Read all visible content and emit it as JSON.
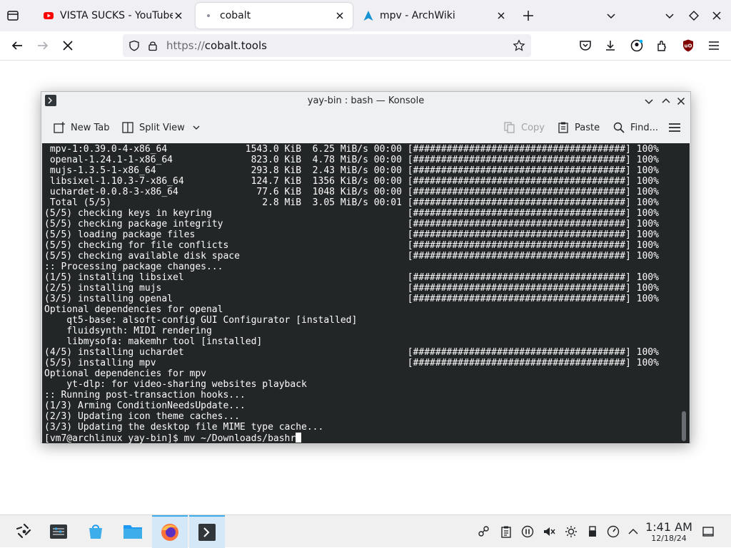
{
  "browser": {
    "tabs": [
      {
        "title": "VISTA SUCKS - YouTube",
        "icon": "youtube-icon",
        "active": false
      },
      {
        "title": "cobalt",
        "icon": "cobalt-icon",
        "active": true
      },
      {
        "title": "mpv - ArchWiki",
        "icon": "archlinux-icon",
        "active": false
      }
    ],
    "url_scheme": "https://",
    "url_host": "cobalt.tools"
  },
  "konsole": {
    "title": "yay-bin : bash — Konsole",
    "toolbar": {
      "new_tab": "New Tab",
      "split_view": "Split View",
      "copy": "Copy",
      "paste": "Paste",
      "find": "Find..."
    },
    "terminal_lines": [
      " mpv-1:0.39.0-4-x86_64              1543.0 KiB  6.25 MiB/s 00:00 [######################################] 100%",
      " openal-1.24.1-1-x86_64              823.0 KiB  4.78 MiB/s 00:00 [######################################] 100%",
      " mujs-1.3.5-1-x86_64                 293.8 KiB  2.43 MiB/s 00:00 [######################################] 100%",
      " libsixel-1.10.3-7-x86_64            124.7 KiB  1356 KiB/s 00:00 [######################################] 100%",
      " uchardet-0.0.8-3-x86_64              77.6 KiB  1048 KiB/s 00:00 [######################################] 100%",
      " Total (5/5)                           2.8 MiB  3.05 MiB/s 00:01 [######################################] 100%",
      "(5/5) checking keys in keyring                                   [######################################] 100%",
      "(5/5) checking package integrity                                 [######################################] 100%",
      "(5/5) loading package files                                      [######################################] 100%",
      "(5/5) checking for file conflicts                                [######################################] 100%",
      "(5/5) checking available disk space                              [######################################] 100%",
      ":: Processing package changes...",
      "(1/5) installing libsixel                                        [######################################] 100%",
      "(2/5) installing mujs                                            [######################################] 100%",
      "(3/5) installing openal                                          [######################################] 100%",
      "Optional dependencies for openal",
      "    qt5-base: alsoft-config GUI Configurator [installed]",
      "    fluidsynth: MIDI rendering",
      "    libmysofa: makemhr tool [installed]",
      "(4/5) installing uchardet                                        [######################################] 100%",
      "(5/5) installing mpv                                             [######################################] 100%",
      "Optional dependencies for mpv",
      "    yt-dlp: for video-sharing websites playback",
      ":: Running post-transaction hooks...",
      "(1/3) Arming ConditionNeedsUpdate...",
      "(2/3) Updating icon theme caches...",
      "(3/3) Updating the desktop file MIME type cache..."
    ],
    "prompt": "[vm7@archlinux yay-bin]$ mv ~/Downloads/bashr"
  },
  "taskbar": {
    "time": "1:41 AM",
    "date": "12/18/24"
  }
}
